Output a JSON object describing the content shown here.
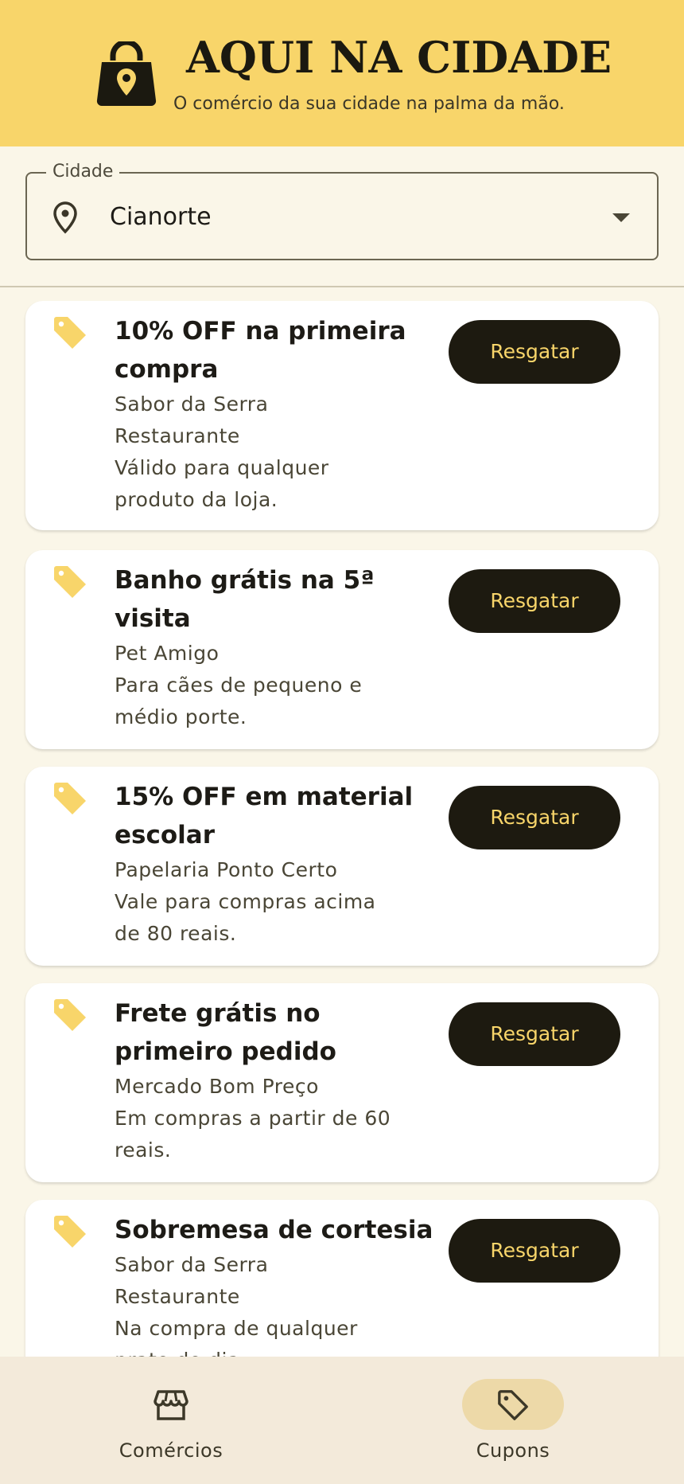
{
  "header": {
    "title": "AQUI NA CIDADE",
    "subtitle": "O comércio da sua cidade na palma da mão.",
    "logo_icon": "shopping-bag-pin-icon"
  },
  "city_select": {
    "label": "Cidade",
    "value": "Cianorte",
    "icon": "location-pin-icon"
  },
  "coupons": [
    {
      "title_lines": [
        "10% OFF na primeira",
        "compra"
      ],
      "store_lines": [
        "Sabor da Serra",
        "Restaurante"
      ],
      "desc_lines": [
        "Válido para qualquer",
        "produto da loja."
      ],
      "button": "Resgatar"
    },
    {
      "title_lines": [
        "Banho grátis na 5ª",
        "visita"
      ],
      "store_lines": [
        "Pet Amigo"
      ],
      "desc_lines": [
        "Para cães de pequeno e",
        "médio porte."
      ],
      "button": "Resgatar"
    },
    {
      "title_lines": [
        "15% OFF em material",
        "escolar"
      ],
      "store_lines": [
        "Papelaria Ponto Certo"
      ],
      "desc_lines": [
        "Vale para compras acima",
        "de 80 reais."
      ],
      "button": "Resgatar"
    },
    {
      "title_lines": [
        "Frete grátis no",
        "primeiro pedido"
      ],
      "store_lines": [
        "Mercado Bom Preço"
      ],
      "desc_lines": [
        "Em compras a partir de 60",
        "reais."
      ],
      "button": "Resgatar"
    },
    {
      "title_lines": [
        "Sobremesa de cortesia"
      ],
      "store_lines": [
        "Sabor da Serra",
        "Restaurante"
      ],
      "desc_lines": [
        "Na compra de qualquer",
        "prato do dia."
      ],
      "button": "Resgatar"
    }
  ],
  "bottom_nav": {
    "items": [
      {
        "label": "Comércios",
        "icon": "storefront-icon",
        "active": false
      },
      {
        "label": "Cupons",
        "icon": "tag-icon",
        "active": true
      }
    ]
  },
  "colors": {
    "header_bg": "#F8D56A",
    "page_bg": "#FAF6E8",
    "button_bg": "#1D1A10",
    "button_text": "#F8D56A",
    "tag_icon": "#F8D56A",
    "nav_bg": "#F3EADA",
    "nav_active_pill": "#EDD9A8"
  }
}
